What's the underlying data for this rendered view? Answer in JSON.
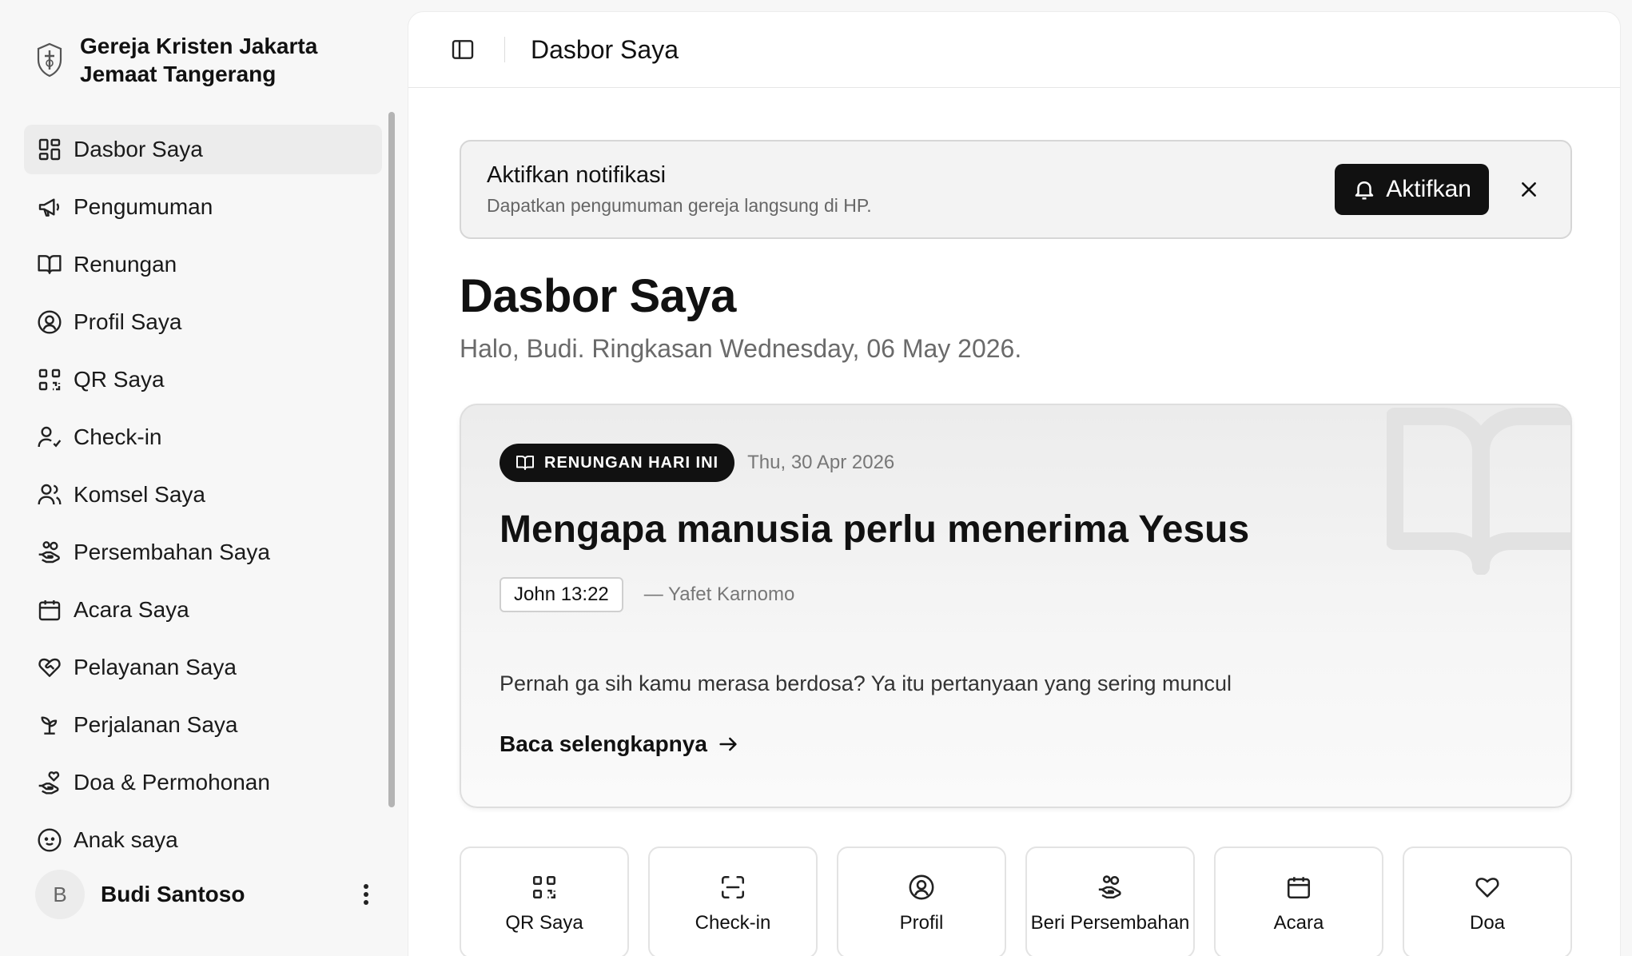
{
  "brand": {
    "name_line1": "Gereja Kristen Jakarta",
    "name_line2": "Jemaat Tangerang"
  },
  "sidebar": {
    "items": [
      {
        "label": "Dasbor Saya",
        "icon": "dashboard-icon",
        "active": true
      },
      {
        "label": "Pengumuman",
        "icon": "megaphone-icon"
      },
      {
        "label": "Renungan",
        "icon": "book-open-icon"
      },
      {
        "label": "Profil Saya",
        "icon": "user-circle-icon"
      },
      {
        "label": "QR Saya",
        "icon": "qr-code-icon"
      },
      {
        "label": "Check-in",
        "icon": "user-check-icon"
      },
      {
        "label": "Komsel Saya",
        "icon": "users-icon"
      },
      {
        "label": "Persembahan Saya",
        "icon": "hand-coins-icon"
      },
      {
        "label": "Acara Saya",
        "icon": "calendar-icon"
      },
      {
        "label": "Pelayanan Saya",
        "icon": "heart-handshake-icon"
      },
      {
        "label": "Perjalanan Saya",
        "icon": "sprout-icon"
      },
      {
        "label": "Doa & Permohonan",
        "icon": "hand-heart-icon"
      },
      {
        "label": "Anak saya",
        "icon": "baby-icon"
      }
    ]
  },
  "user": {
    "initial": "B",
    "name": "Budi Santoso"
  },
  "topbar": {
    "title": "Dasbor Saya"
  },
  "notice": {
    "title": "Aktifkan notifikasi",
    "subtitle": "Dapatkan pengumuman gereja langsung di HP.",
    "button_label": "Aktifkan"
  },
  "page": {
    "title": "Dasbor Saya",
    "subtitle": "Halo, Budi. Ringkasan Wednesday, 06 May 2026."
  },
  "devotional": {
    "badge": "RENUNGAN HARI INI",
    "date": "Thu, 30 Apr 2026",
    "title": "Mengapa manusia perlu menerima Yesus",
    "verse": "John 13:22",
    "author": "— Yafet Karnomo",
    "excerpt": "Pernah ga sih kamu merasa berdosa? Ya itu pertanyaan yang sering muncul",
    "read_more": "Baca selengkapnya"
  },
  "quick_actions": [
    {
      "label": "QR Saya",
      "icon": "qr-code-icon"
    },
    {
      "label": "Check-in",
      "icon": "scan-icon"
    },
    {
      "label": "Profil",
      "icon": "user-circle-icon"
    },
    {
      "label": "Beri Persembahan",
      "icon": "hand-coins-icon"
    },
    {
      "label": "Acara",
      "icon": "calendar-icon"
    },
    {
      "label": "Doa",
      "icon": "heart-icon"
    }
  ],
  "colors": {
    "accent": "#111111",
    "sidebar_bg": "#f7f7f7",
    "active_item_bg": "#ececec"
  }
}
